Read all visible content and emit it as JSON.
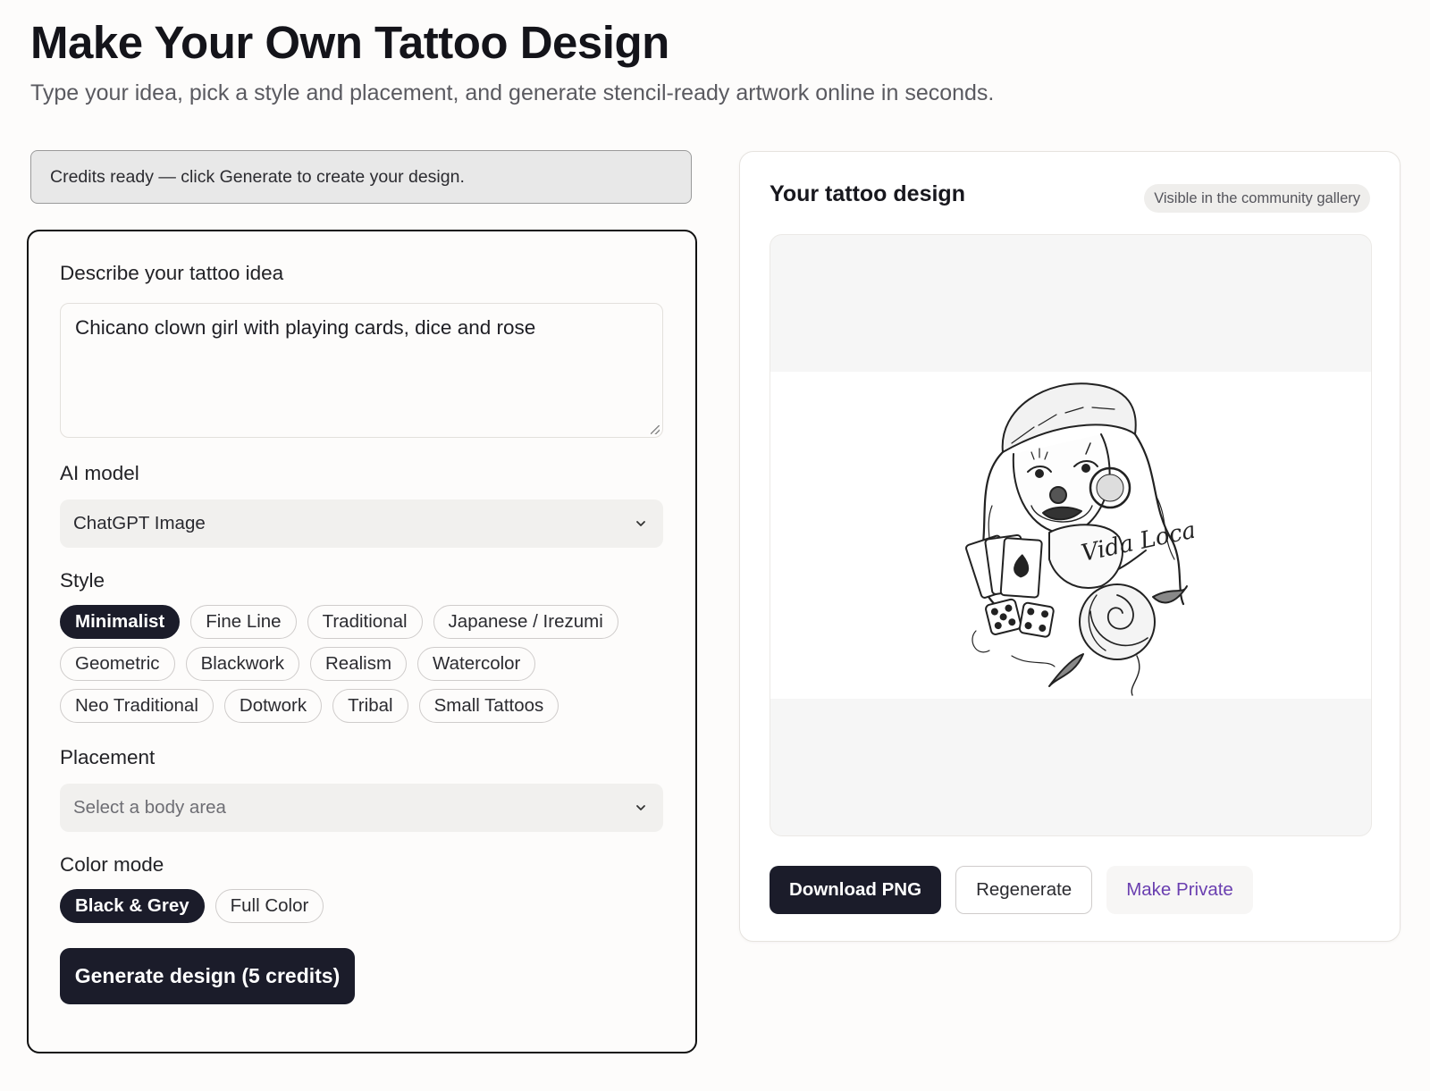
{
  "header": {
    "title": "Make Your Own Tattoo Design",
    "subtitle": "Type your idea, pick a style and placement, and generate stencil-ready artwork online in seconds."
  },
  "credits_banner": "Credits ready — click Generate to create your design.",
  "form": {
    "idea_label": "Describe your tattoo idea",
    "idea_value": "Chicano clown girl with playing cards, dice and rose",
    "model_label": "AI model",
    "model_value": "ChatGPT Image",
    "style_label": "Style",
    "styles": [
      "Minimalist",
      "Fine Line",
      "Traditional",
      "Japanese / Irezumi",
      "Geometric",
      "Blackwork",
      "Realism",
      "Watercolor",
      "Neo Traditional",
      "Dotwork",
      "Tribal",
      "Small Tattoos"
    ],
    "selected_style": "Minimalist",
    "placement_label": "Placement",
    "placement_placeholder": "Select a body area",
    "color_label": "Color mode",
    "color_modes": [
      "Black & Grey",
      "Full Color"
    ],
    "selected_color_mode": "Black & Grey",
    "generate_label": "Generate design (5 credits)"
  },
  "result": {
    "title": "Your tattoo design",
    "visibility": "Visible in the community gallery",
    "image_text": "Vida Loca",
    "download_label": "Download PNG",
    "regenerate_label": "Regenerate",
    "private_label": "Make Private"
  },
  "colors": {
    "accent_dark": "#1b1c2a",
    "link_purple": "#6a3fb0"
  }
}
